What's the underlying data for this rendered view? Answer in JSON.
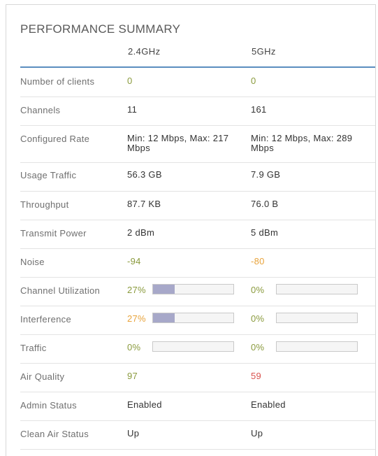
{
  "title": "PERFORMANCE SUMMARY",
  "columns": [
    "2.4GHz",
    "5GHz"
  ],
  "rows": [
    {
      "label": "Number of clients",
      "v24": "0",
      "v5": "0"
    },
    {
      "label": "Channels",
      "v24": "11",
      "v5": "161"
    },
    {
      "label": "Configured Rate",
      "v24": "Min: 12 Mbps, Max: 217 Mbps",
      "v5": "Min: 12 Mbps, Max: 289 Mbps"
    },
    {
      "label": "Usage Traffic",
      "v24": "56.3 GB",
      "v5": "7.9 GB"
    },
    {
      "label": "Throughput",
      "v24": "87.7 KB",
      "v5": "76.0 B"
    },
    {
      "label": "Transmit Power",
      "v24": "2 dBm",
      "v5": "5 dBm"
    },
    {
      "label": "Noise",
      "v24": "-94",
      "v5": "-80"
    },
    {
      "label": "Channel Utilization",
      "v24": "27%",
      "v5": "0%",
      "v24_fill": 0.27,
      "v5_fill": 0
    },
    {
      "label": "Interference",
      "v24": "27%",
      "v5": "0%",
      "v24_fill": 0.27,
      "v5_fill": 0
    },
    {
      "label": "Traffic",
      "v24": "0%",
      "v5": "0%",
      "v24_fill": 0,
      "v5_fill": 0
    },
    {
      "label": "Air Quality",
      "v24": "97",
      "v5": "59"
    },
    {
      "label": "Admin Status",
      "v24": "Enabled",
      "v5": "Enabled"
    },
    {
      "label": "Clean Air Status",
      "v24": "Up",
      "v5": "Up"
    }
  ],
  "colors": {
    "rule": "#5b8dbf",
    "good": "#8a9a3d",
    "warn": "#e8a33b",
    "bad": "#d9534f",
    "bar_fill": "#a7a8c9"
  }
}
